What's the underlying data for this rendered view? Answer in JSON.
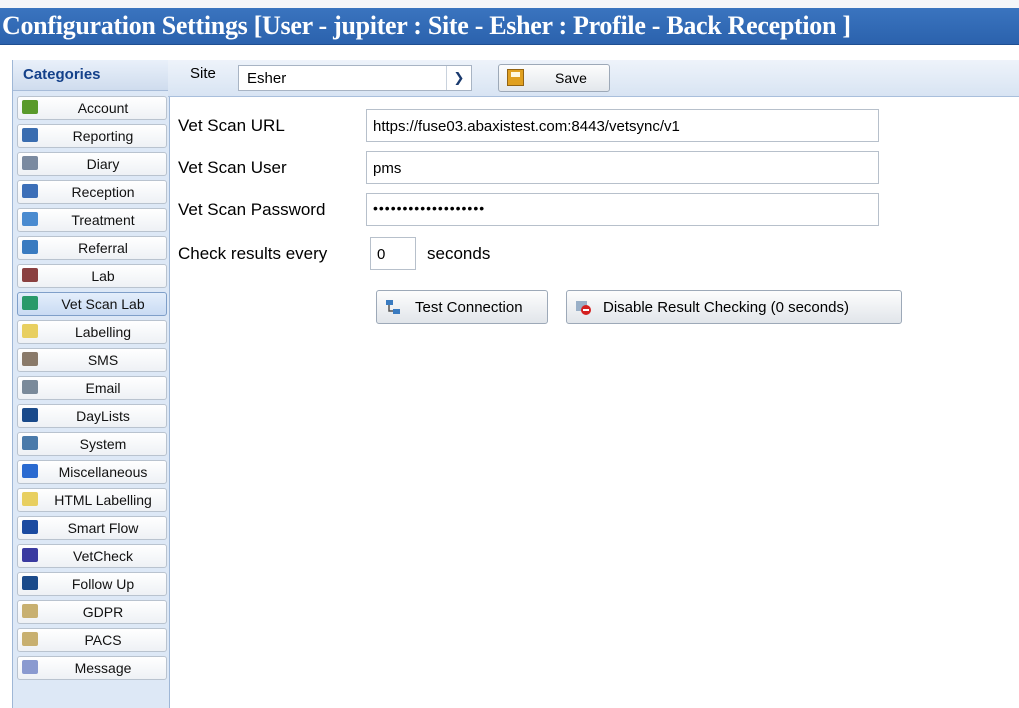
{
  "window": {
    "title": "Configuration Settings [User - jupiter : Site - Esher : Profile - Back Reception ]"
  },
  "sidebar": {
    "header": "Categories",
    "items": [
      {
        "label": "Account",
        "icon": "account-icon",
        "color": "#5a9a2a"
      },
      {
        "label": "Reporting",
        "icon": "reporting-icon",
        "color": "#3a6db0"
      },
      {
        "label": "Diary",
        "icon": "diary-icon",
        "color": "#7a8aa0"
      },
      {
        "label": "Reception",
        "icon": "reception-icon",
        "color": "#3c6fb8"
      },
      {
        "label": "Treatment",
        "icon": "treatment-icon",
        "color": "#4a8bd0"
      },
      {
        "label": "Referral",
        "icon": "referral-icon",
        "color": "#3a7bc0"
      },
      {
        "label": "Lab",
        "icon": "lab-icon",
        "color": "#8a4040"
      },
      {
        "label": "Vet Scan Lab",
        "icon": "vetscan-icon",
        "color": "#2a9a6a",
        "selected": true
      },
      {
        "label": "Labelling",
        "icon": "labelling-icon",
        "color": "#e8cf60"
      },
      {
        "label": "SMS",
        "icon": "sms-icon",
        "color": "#8a7a6a"
      },
      {
        "label": "Email",
        "icon": "email-icon",
        "color": "#7a8a9a"
      },
      {
        "label": "DayLists",
        "icon": "daylists-icon",
        "color": "#1a4a8a"
      },
      {
        "label": "System",
        "icon": "system-icon",
        "color": "#4a7aaa"
      },
      {
        "label": "Miscellaneous",
        "icon": "info-icon",
        "color": "#2a6ad0"
      },
      {
        "label": "HTML Labelling",
        "icon": "html-labelling-icon",
        "color": "#e8cf60"
      },
      {
        "label": "Smart Flow",
        "icon": "smartflow-icon",
        "color": "#1a4aa0"
      },
      {
        "label": "VetCheck",
        "icon": "vetcheck-icon",
        "color": "#3a3aa0"
      },
      {
        "label": "Follow Up",
        "icon": "followup-icon",
        "color": "#1a4a8a"
      },
      {
        "label": "GDPR",
        "icon": "gdpr-icon",
        "color": "#c8b070"
      },
      {
        "label": "PACS",
        "icon": "pacs-icon",
        "color": "#c8b070"
      },
      {
        "label": "Message",
        "icon": "message-icon",
        "color": "#8a9ad0"
      }
    ]
  },
  "toolbar": {
    "site_label": "Site",
    "site_value": "Esher",
    "save_label": "Save"
  },
  "form": {
    "url_label": "Vet Scan URL",
    "url_value": "https://fuse03.abaxistest.com:8443/vetsync/v1",
    "user_label": "Vet Scan User",
    "user_value": "pms",
    "password_label": "Vet Scan Password",
    "password_value": "•••••••••••••••••••",
    "interval_prefix": "Check results every",
    "interval_value": "0",
    "interval_suffix": "seconds"
  },
  "actions": {
    "test_label": "Test Connection",
    "disable_label": "Disable Result Checking (0 seconds)"
  }
}
